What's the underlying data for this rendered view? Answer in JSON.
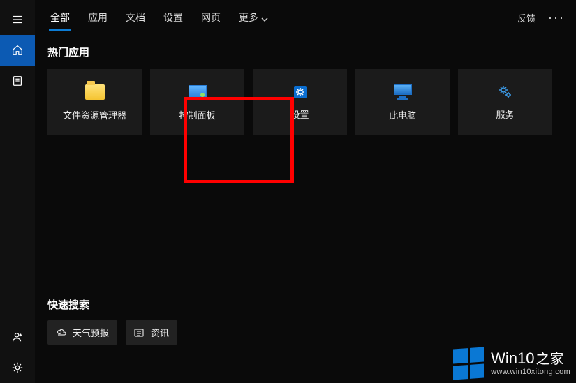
{
  "tabs": {
    "items": [
      "全部",
      "应用",
      "文档",
      "设置",
      "网页"
    ],
    "more": "更多",
    "active": 0
  },
  "header": {
    "feedback": "反馈",
    "more_menu": "···"
  },
  "sections": {
    "top_apps_title": "热门应用",
    "quick_search_title": "快速搜索"
  },
  "tiles": [
    {
      "id": "file-explorer",
      "label": "文件资源管理器",
      "icon": "folder-icon"
    },
    {
      "id": "control-panel",
      "label": "控制面板",
      "icon": "control-panel-icon",
      "highlighted": true
    },
    {
      "id": "settings",
      "label": "设置",
      "icon": "gear-icon"
    },
    {
      "id": "this-pc",
      "label": "此电脑",
      "icon": "monitor-icon"
    },
    {
      "id": "services",
      "label": "服务",
      "icon": "gears-icon"
    }
  ],
  "quick_chips": [
    {
      "id": "weather",
      "label": "天气预报",
      "icon": "weather-icon"
    },
    {
      "id": "news",
      "label": "资讯",
      "icon": "news-icon"
    }
  ],
  "watermark": {
    "brand_prefix": "Win10",
    "brand_suffix": "之家",
    "url": "www.win10xitong.com"
  },
  "colors": {
    "accent": "#0c7cd5",
    "highlight": "#ff0000",
    "tile_bg": "#1b1b1b"
  }
}
